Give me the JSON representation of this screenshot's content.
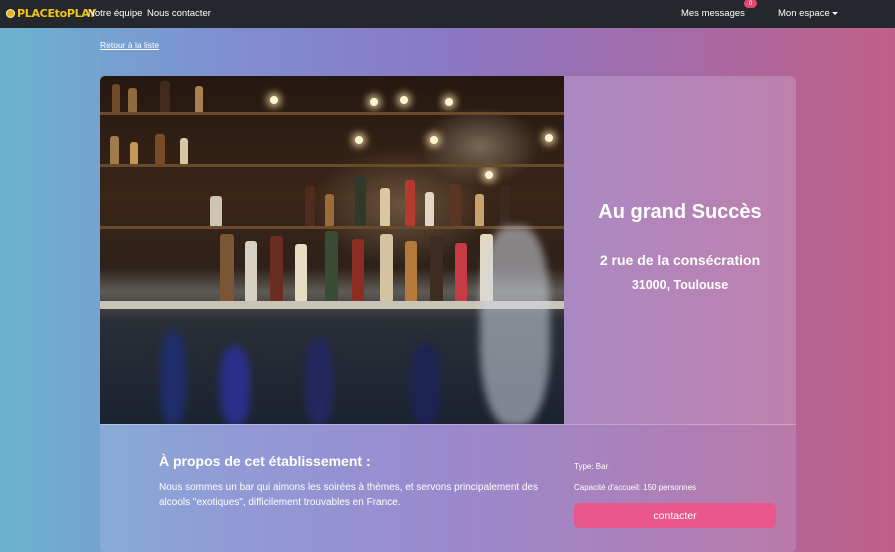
{
  "nav": {
    "logo_text": "PLACEtoPLAY",
    "links": [
      "Notre équipe",
      "Nous contacter"
    ],
    "messages_label": "Mes messages",
    "messages_count": "0",
    "account_label": "Mon espace"
  },
  "back_link": "Retour à la liste",
  "venue": {
    "name": "Au grand Succès",
    "street": "2 rue de la consécration",
    "city": "31000, Toulouse",
    "photo_subject": "bar-shelves-with-bottles"
  },
  "about": {
    "title": "À propos de cet établissement :",
    "text": "Nous sommes un bar qui aimons les soirées à thèmes, et servons principalement des alcools \"exotiques\", difficilement trouvables en France.",
    "type_label": "Type: Bar",
    "capacity_label": "Capacité d'accueil: 150 personnes",
    "contact_button": "contacter"
  },
  "colors": {
    "navbar": "#24272c",
    "accent_button": "#e9568a",
    "badge": "#e0466f",
    "logo": "#f2c318"
  }
}
